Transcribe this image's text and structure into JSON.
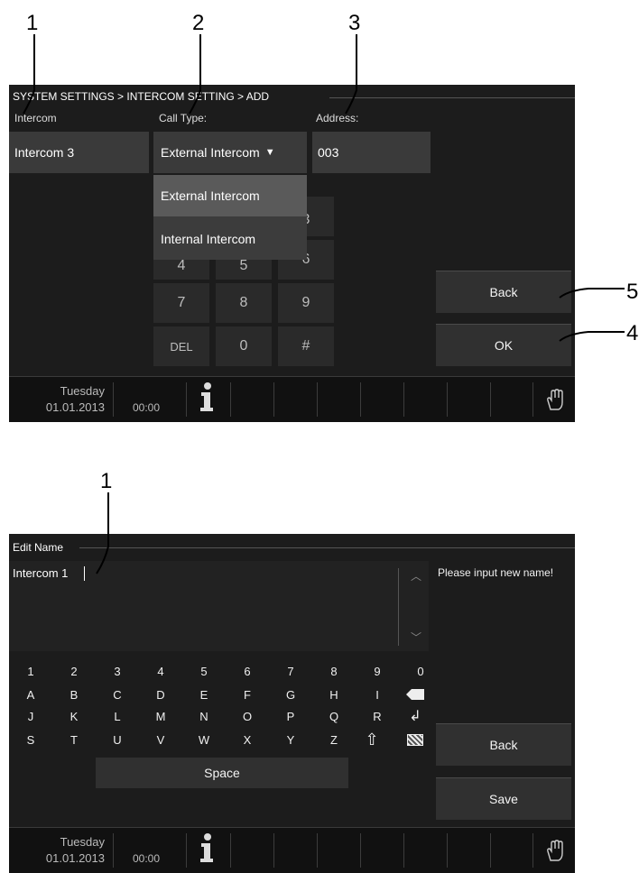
{
  "callouts": {
    "top": [
      "1",
      "2",
      "3",
      "5",
      "4"
    ],
    "bottom": [
      "1"
    ]
  },
  "screen1": {
    "breadcrumb": "SYSTEM SETTINGS > INTERCOM SETTING > ADD",
    "intercom_label": "Intercom",
    "call_type_label": "Call Type:",
    "address_label": "Address:",
    "intercom_value": "Intercom 3",
    "call_type_value": "External Intercom",
    "address_value": "003",
    "dropdown_options": [
      "External Intercom",
      "Internal Intercom"
    ],
    "dropdown_selected": "External Intercom",
    "keypad_partial": [
      "3",
      "4",
      "5",
      "6"
    ],
    "keypad": [
      "7",
      "8",
      "9",
      "DEL",
      "0",
      "#"
    ],
    "back_label": "Back",
    "ok_label": "OK",
    "status": {
      "day": "Tuesday",
      "date": "01.01.2013",
      "time": "00:00"
    }
  },
  "screen2": {
    "title": "Edit Name",
    "text_value": "Intercom 1",
    "hint": "Please input new name!",
    "keyboard": {
      "row1": [
        "1",
        "2",
        "3",
        "4",
        "5",
        "6",
        "7",
        "8",
        "9",
        "0"
      ],
      "row2": [
        "A",
        "B",
        "C",
        "D",
        "E",
        "F",
        "G",
        "H",
        "I"
      ],
      "row3": [
        "J",
        "K",
        "L",
        "M",
        "N",
        "O",
        "P",
        "Q",
        "R"
      ],
      "row4": [
        "S",
        "T",
        "U",
        "V",
        "W",
        "X",
        "Y",
        "Z"
      ]
    },
    "space_label": "Space",
    "back_label": "Back",
    "save_label": "Save",
    "status": {
      "day": "Tuesday",
      "date": "01.01.2013",
      "time": "00:00"
    }
  },
  "colors": {
    "screen_bg": "#1c1c1c",
    "field_bg": "#3a3a3a",
    "selected_option_bg": "#5a5a5a"
  }
}
